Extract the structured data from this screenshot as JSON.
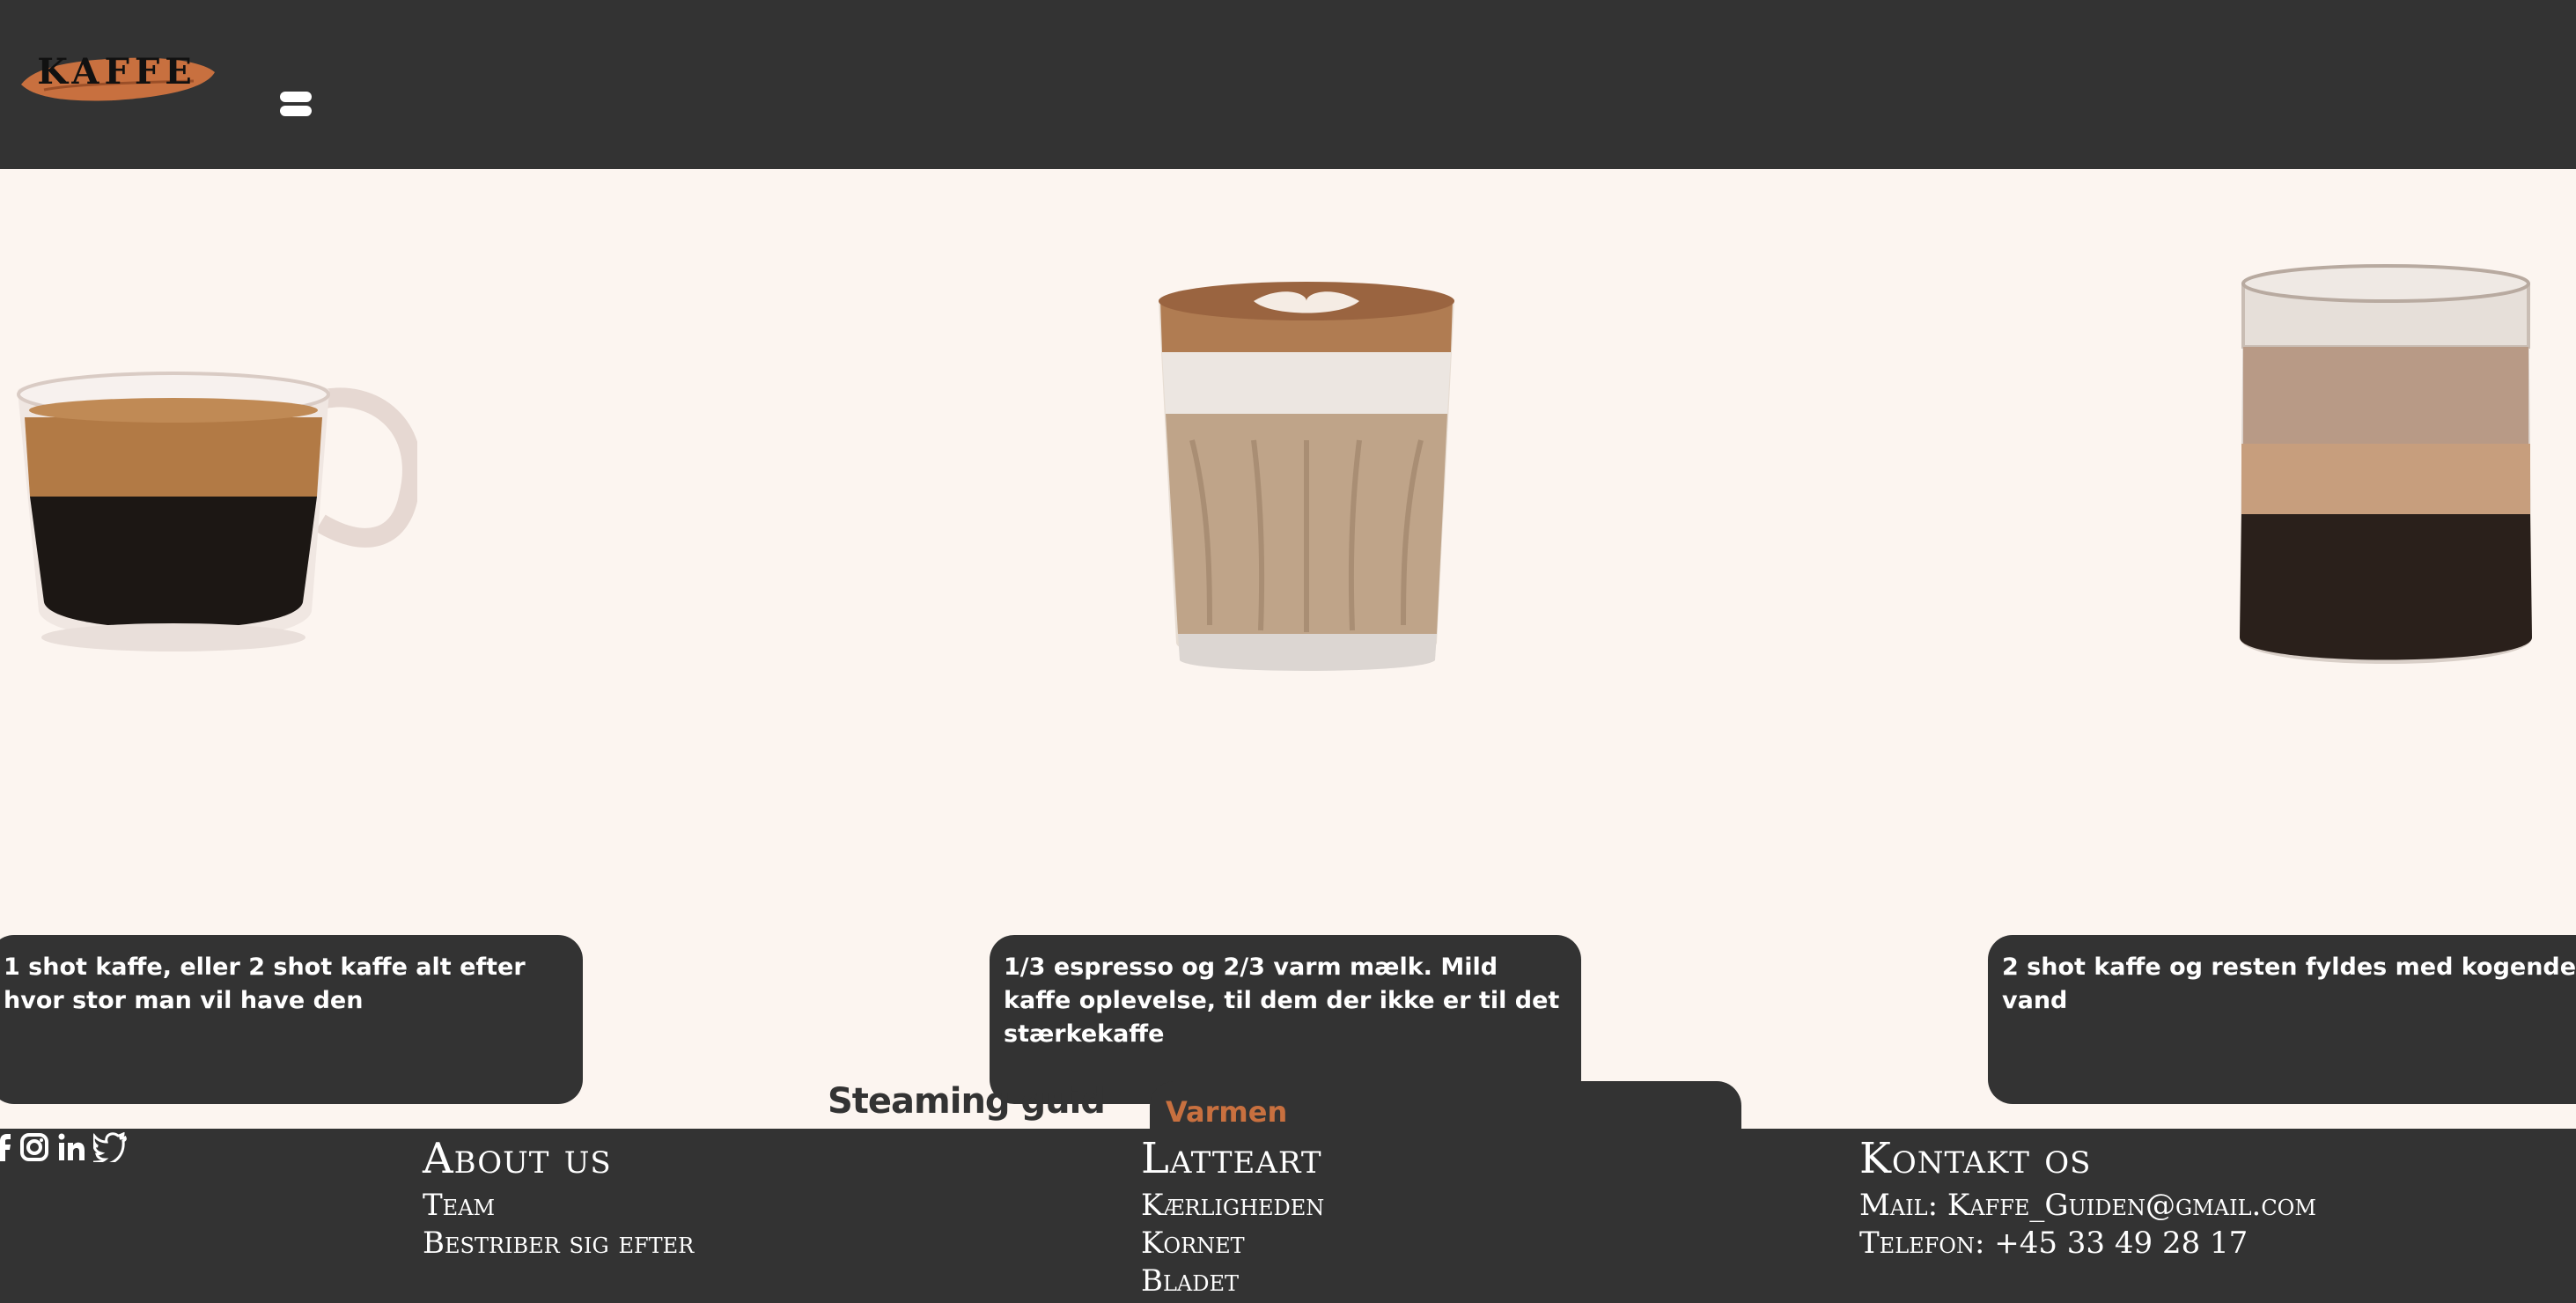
{
  "header": {
    "logo_text": "KAFFE",
    "brand_color": "#c8703f",
    "background": "#333333",
    "menu_icon": "hamburger-menu-icon"
  },
  "main": {
    "background": "#fcf5f0",
    "drinks": [
      {
        "image": "espresso-cup-image",
        "description": "1 shot kaffe, eller 2 shot kaffe alt efter hvor stor man vil have den"
      },
      {
        "image": "latte-glass-image",
        "description": "1/3 espresso og 2/3 varm mælk. Mild kaffe oplevelse, til dem der ikke er til det stærkekaffe"
      },
      {
        "image": "americano-jar-image",
        "description": "2 shot kaffe og resten fyldes med kogende vand"
      }
    ],
    "steaming_title": "Steaming guid",
    "steaming_tab_label": "Varmen"
  },
  "footer": {
    "social_icons": [
      "facebook-icon",
      "instagram-icon",
      "linkedin-icon",
      "twitter-icon"
    ],
    "about": {
      "title": "About us",
      "items": [
        "Team",
        "Bestriber sig efter"
      ]
    },
    "latteart": {
      "title": "Latteart",
      "items": [
        "Kærligheden",
        "Kornet",
        "Bladet"
      ]
    },
    "kontakt": {
      "title": "Kontakt os",
      "items": [
        "Mail: Kaffe_Guiden@gmail.com",
        "Telefon: +45 33 49 28 17"
      ]
    }
  }
}
